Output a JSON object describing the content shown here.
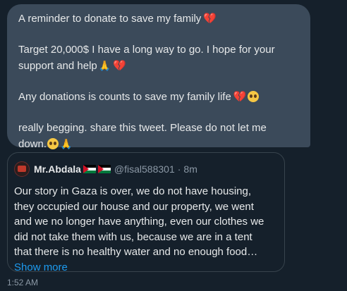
{
  "message": {
    "line1": "A reminder to donate to save my family",
    "line2": "Target 20,000$ I have a long way to go. I hope for your",
    "line3": "support and help",
    "line4": "Any  donations is counts to save my family life",
    "line5": "really begging. share this tweet. Please do not let me",
    "line6": "down."
  },
  "quoted_tweet": {
    "author_name": "Mr.Abdala",
    "handle": "@fisal588301",
    "separator": "·",
    "time_ago": "8m",
    "body_lines": [
      "Our story in Gaza is over, we do not have housing,",
      "they occupied our house and our property, we went",
      "and we no longer have anything, even our clothes we",
      "did not take them with us, because we are in a tent",
      "that there is no healthy water and no enough food…"
    ],
    "show_more_label": "Show more",
    "link_color": "#1d9bf0"
  },
  "timestamp": "1:52 AM",
  "emoji": {
    "heart": "💔",
    "hands": "🙏",
    "heart_color": "#e0245e"
  },
  "icons": {
    "avatar": "avatar-icon",
    "flag": "palestine-flag-icon"
  },
  "theme": {
    "background": "#15202b",
    "bubble": "#3b4a5a",
    "text": "#e7e9ea",
    "muted": "#8b98a5",
    "border": "#38444d"
  }
}
